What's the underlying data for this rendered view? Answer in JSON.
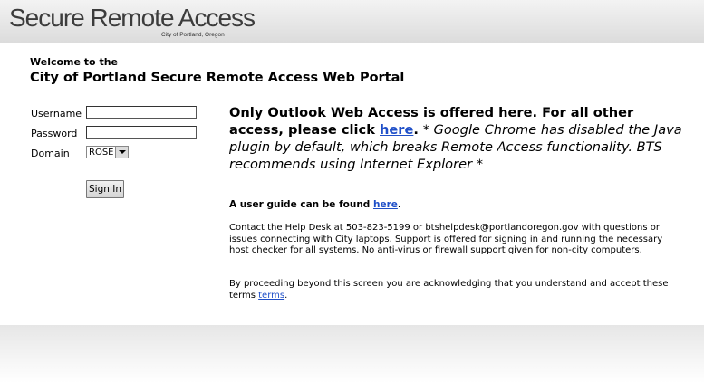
{
  "header": {
    "title": "Secure Remote Access",
    "subtitle": "City of Portland, Oregon"
  },
  "welcome": {
    "line1": "Welcome to the",
    "line2": "City of Portland Secure Remote Access Web Portal"
  },
  "form": {
    "username_label": "Username",
    "username_value": "",
    "password_label": "Password",
    "password_value": "",
    "domain_label": "Domain",
    "domain_value": "ROSE",
    "signin_label": "Sign In"
  },
  "notice": {
    "line_a": "Only Outlook Web Access is offered here. For all other access, please click ",
    "link": "here",
    "period": ".",
    "italic": " * Google Chrome has disabled the Java plugin by default, which breaks Remote Access functionality. BTS recommends using Internet Explorer *"
  },
  "guide": {
    "text": "A user guide can be found ",
    "link": "here",
    "period": "."
  },
  "helpdesk": {
    "text": "Contact the Help Desk at 503-823-5199 or btshelpdesk@portlandoregon.gov with questions or issues connecting with City laptops. Support is offered for signing in and running the necessary host checker for all systems. No anti-virus or firewall support given for non-city computers."
  },
  "terms": {
    "text": "By proceeding beyond this screen you are acknowledging that you understand and accept these terms ",
    "link": "terms",
    "period": "."
  },
  "colors": {
    "link": "#1f4fc8",
    "header_border": "#555555"
  }
}
